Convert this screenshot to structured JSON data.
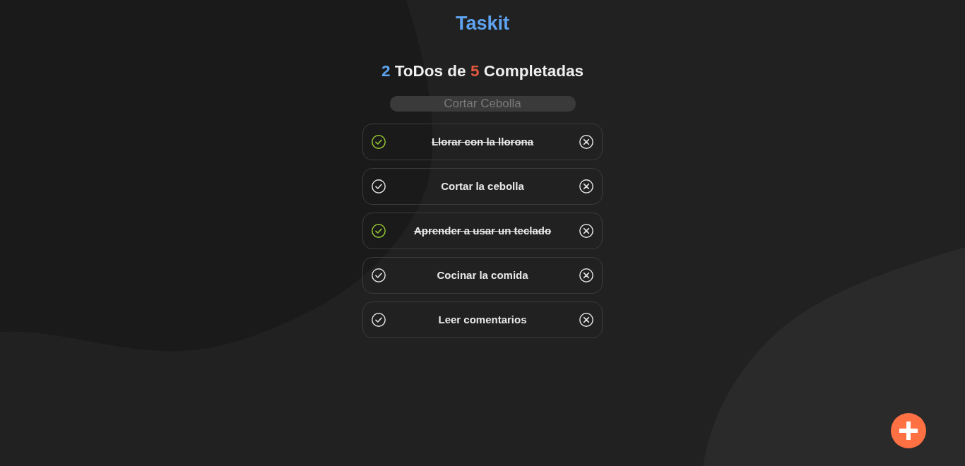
{
  "app": {
    "title": "Taskit"
  },
  "counter": {
    "completed": "2",
    "label_middle": "ToDos de",
    "total": "5",
    "label_end": "Completadas"
  },
  "search": {
    "placeholder": "Cortar Cebolla"
  },
  "todos": [
    {
      "text": "Llorar con la llorona",
      "completed": true
    },
    {
      "text": "Cortar la cebolla",
      "completed": false
    },
    {
      "text": "Aprender a usar un teclado",
      "completed": true
    },
    {
      "text": "Cocinar la comida",
      "completed": false
    },
    {
      "text": "Leer comentarios",
      "completed": false
    }
  ]
}
